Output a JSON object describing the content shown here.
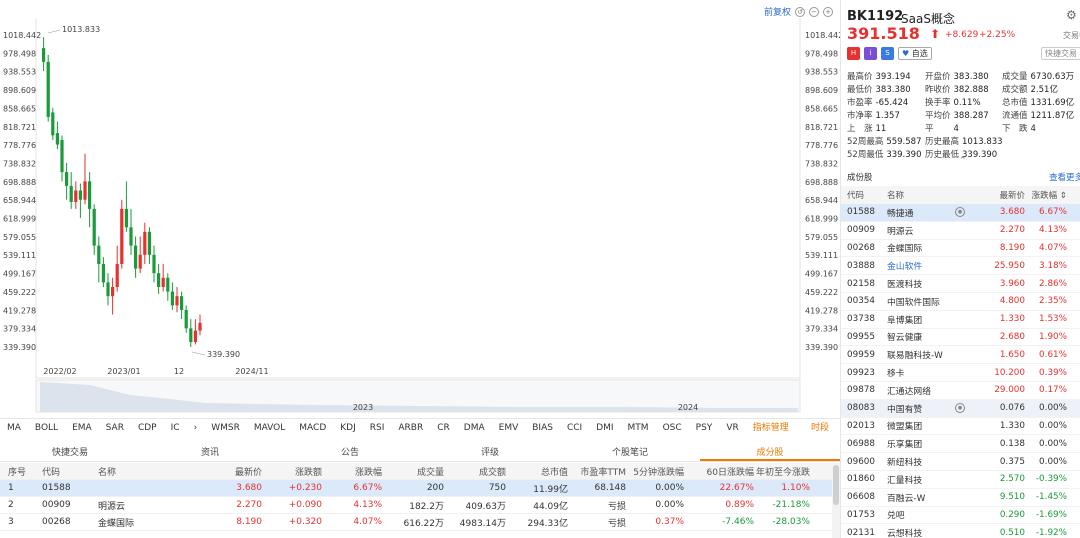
{
  "toolbar": {
    "restore_label": "前复权",
    "icons": [
      "undo-icon",
      "zoom-out-icon",
      "zoom-in-icon"
    ]
  },
  "chart": {
    "type": "candlestick",
    "y_ticks": [
      "1018.442",
      "978.498",
      "938.553",
      "898.609",
      "858.665",
      "818.721",
      "778.776",
      "738.832",
      "698.888",
      "658.944",
      "618.999",
      "579.055",
      "539.111",
      "499.167",
      "459.222",
      "419.278",
      "379.334",
      "339.390"
    ],
    "left_ticks": [
      "1018.442",
      "978.498",
      "938.553",
      "898.609",
      "858.665",
      "818.721",
      "778.776",
      "738.832",
      "698.888",
      "658.944",
      "618.999",
      "579.055",
      "539.111",
      "499.167",
      "459.222",
      "419.278",
      "379.334",
      "339.390"
    ],
    "x_ticks": [
      "2022/02",
      "2023/01",
      "12",
      "2024/11"
    ],
    "high_annotation": "1013.833",
    "low_annotation": "339.390",
    "colors": {
      "up": "#e8312f",
      "down": "#1a9b3a"
    },
    "nav_labels": [
      "2023",
      "2024"
    ]
  },
  "indicators": [
    "MA",
    "BOLL",
    "EMA",
    "SAR",
    "CDP",
    "IC",
    "WMSR",
    "MAVOL",
    "MACD",
    "KDJ",
    "RSI",
    "ARBR",
    "CR",
    "DMA",
    "EMV",
    "BIAS",
    "CCI",
    "DMI",
    "MTM",
    "OSC",
    "PSY",
    "VR"
  ],
  "indicator_extra": {
    "manage": "指标管理",
    "period": "时段"
  },
  "bottom_tabs": [
    "快捷交易",
    "资讯",
    "公告",
    "评级",
    "个股笔记",
    "成分股"
  ],
  "bottom_table": {
    "headers": [
      "序号",
      "代码",
      "名称",
      "最新价",
      "涨跌额",
      "涨跌幅",
      "成交量",
      "成交额",
      "总市值",
      "市盈率TTM",
      "5分钟涨跌幅",
      "60日涨跌幅",
      "年初至今涨跌"
    ],
    "rows": [
      [
        "1",
        "01588",
        "畅捷通",
        "3.680",
        "+0.230",
        "6.67%",
        "200",
        "750",
        "11.99亿",
        "68.148",
        "0.00%",
        "22.67%",
        "1.10%"
      ],
      [
        "2",
        "00909",
        "明源云",
        "2.270",
        "+0.090",
        "4.13%",
        "182.2万",
        "409.63万",
        "44.09亿",
        "亏损",
        "0.00%",
        "0.89%",
        "-21.18%"
      ],
      [
        "3",
        "00268",
        "金蝶国际",
        "8.190",
        "+0.320",
        "4.07%",
        "616.22万",
        "4983.14万",
        "294.33亿",
        "亏损",
        "0.37%",
        "-7.46%",
        "-28.03%"
      ]
    ]
  },
  "stock": {
    "code": "BK1192",
    "name": "SaaS概念",
    "price": "391.518",
    "change": "+8.629",
    "change_pct": "+2.25%",
    "trade_hint": "交易中",
    "fav_label": "自选",
    "fast_sell_label": "快捷交易",
    "badges": [
      "H",
      "i",
      "S"
    ]
  },
  "stats": [
    [
      {
        "l": "最高价",
        "v": "393.194",
        "c": "red"
      },
      {
        "l": "开盘价",
        "v": "383.380",
        "c": "red"
      },
      {
        "l": "成交量",
        "v": "6730.63万",
        "c": "gray"
      }
    ],
    [
      {
        "l": "最低价",
        "v": "383.380",
        "c": "red"
      },
      {
        "l": "昨收价",
        "v": "382.888",
        "c": "gray"
      },
      {
        "l": "成交额",
        "v": "2.51亿",
        "c": "gray"
      }
    ],
    [
      {
        "l": "市盈率",
        "v": "-65.424",
        "c": "gray"
      },
      {
        "l": "换手率",
        "v": "0.11%",
        "c": "gray"
      },
      {
        "l": "总市值",
        "v": "1331.69亿",
        "c": "gray"
      }
    ],
    [
      {
        "l": "市净率",
        "v": "1.357",
        "c": "gray"
      },
      {
        "l": "平均价",
        "v": "388.287",
        "c": "red"
      },
      {
        "l": "流通值",
        "v": "1211.87亿",
        "c": "gray"
      }
    ],
    [
      {
        "l": "上　涨",
        "v": "11",
        "c": "red"
      },
      {
        "l": "平　　",
        "v": "4",
        "c": "gray"
      },
      {
        "l": "下　跌",
        "v": "4",
        "c": "green"
      }
    ],
    [
      {
        "l": "52周最高",
        "v": "559.587",
        "c": "red"
      },
      {
        "l": "历史最高",
        "v": "1013.833",
        "c": "red"
      },
      {
        "l": "",
        "v": "",
        "c": "gray"
      }
    ],
    [
      {
        "l": "52周最低",
        "v": "339.390",
        "c": "green"
      },
      {
        "l": "历史最低",
        "v": "339.390",
        "c": "green"
      },
      {
        "l": "",
        "v": "",
        "c": "gray"
      }
    ]
  ],
  "components": {
    "title": "成份股",
    "more": "查看更多",
    "headers": [
      "代码",
      "名称",
      "最新价",
      "涨跌幅"
    ],
    "rows": [
      {
        "code": "01588",
        "name": "畅捷通",
        "price": "3.680",
        "pct": "6.67%",
        "dir": "up",
        "sel": true,
        "dot": true
      },
      {
        "code": "00909",
        "name": "明源云",
        "price": "2.270",
        "pct": "4.13%",
        "dir": "up"
      },
      {
        "code": "00268",
        "name": "金蝶国际",
        "price": "8.190",
        "pct": "4.07%",
        "dir": "up"
      },
      {
        "code": "03888",
        "name": "金山软件",
        "price": "25.950",
        "pct": "3.18%",
        "dir": "up",
        "blue": true
      },
      {
        "code": "02158",
        "name": "医渡科技",
        "price": "3.960",
        "pct": "2.86%",
        "dir": "up"
      },
      {
        "code": "00354",
        "name": "中国软件国际",
        "price": "4.800",
        "pct": "2.35%",
        "dir": "up"
      },
      {
        "code": "03738",
        "name": "阜博集团",
        "price": "1.330",
        "pct": "1.53%",
        "dir": "up"
      },
      {
        "code": "09955",
        "name": "智云健康",
        "price": "2.680",
        "pct": "1.90%",
        "dir": "up"
      },
      {
        "code": "09959",
        "name": "联易融科技-W",
        "price": "1.650",
        "pct": "0.61%",
        "dir": "up"
      },
      {
        "code": "09923",
        "name": "移卡",
        "price": "10.200",
        "pct": "0.39%",
        "dir": "up"
      },
      {
        "code": "09878",
        "name": "汇通达网络",
        "price": "29.000",
        "pct": "0.17%",
        "dir": "up"
      },
      {
        "code": "08083",
        "name": "中国有赞",
        "price": "0.076",
        "pct": "0.00%",
        "dir": "flat",
        "hl": true,
        "dot": true
      },
      {
        "code": "02013",
        "name": "微盟集团",
        "price": "1.330",
        "pct": "0.00%",
        "dir": "flat"
      },
      {
        "code": "06988",
        "name": "乐享集团",
        "price": "0.138",
        "pct": "0.00%",
        "dir": "flat"
      },
      {
        "code": "09600",
        "name": "新纽科技",
        "price": "0.375",
        "pct": "0.00%",
        "dir": "flat"
      },
      {
        "code": "01860",
        "name": "汇量科技",
        "price": "2.570",
        "pct": "-0.39%",
        "dir": "down"
      },
      {
        "code": "06608",
        "name": "百融云-W",
        "price": "9.510",
        "pct": "-1.45%",
        "dir": "down"
      },
      {
        "code": "01753",
        "name": "兑吧",
        "price": "0.290",
        "pct": "-1.69%",
        "dir": "down"
      },
      {
        "code": "02131",
        "name": "云想科技",
        "price": "0.510",
        "pct": "-1.92%",
        "dir": "down"
      }
    ]
  },
  "chart_data": {
    "type": "candlestick",
    "ylim": [
      339.39,
      1018.442
    ],
    "x_ticks": [
      "2022/02",
      "2023/01",
      "12",
      "2024/11"
    ],
    "candles": [
      [
        990,
        960,
        1013.8,
        940
      ],
      [
        960,
        840,
        975,
        830
      ],
      [
        850,
        800,
        860,
        790
      ],
      [
        805,
        780,
        830,
        770
      ],
      [
        790,
        720,
        800,
        700
      ],
      [
        720,
        690,
        740,
        660
      ],
      [
        690,
        655,
        720,
        640
      ],
      [
        655,
        680,
        700,
        640
      ],
      [
        680,
        660,
        695,
        620
      ],
      [
        660,
        700,
        760,
        650
      ],
      [
        700,
        640,
        720,
        600
      ],
      [
        640,
        560,
        650,
        540
      ],
      [
        560,
        520,
        580,
        480
      ],
      [
        520,
        480,
        535,
        470
      ],
      [
        480,
        450,
        500,
        430
      ],
      [
        450,
        470,
        490,
        410
      ],
      [
        470,
        520,
        560,
        460
      ],
      [
        520,
        640,
        660,
        510
      ],
      [
        640,
        600,
        700,
        590
      ],
      [
        600,
        560,
        640,
        540
      ],
      [
        560,
        510,
        580,
        490
      ],
      [
        510,
        540,
        580,
        500
      ],
      [
        540,
        590,
        610,
        520
      ],
      [
        590,
        540,
        600,
        520
      ],
      [
        540,
        500,
        560,
        480
      ],
      [
        500,
        470,
        520,
        455
      ],
      [
        470,
        490,
        520,
        460
      ],
      [
        490,
        460,
        500,
        440
      ],
      [
        460,
        430,
        480,
        420
      ],
      [
        430,
        450,
        470,
        415
      ],
      [
        450,
        420,
        460,
        400
      ],
      [
        420,
        380,
        430,
        370
      ],
      [
        380,
        350,
        400,
        339.4
      ],
      [
        350,
        375,
        400,
        345
      ],
      [
        375,
        392,
        410,
        365
      ]
    ]
  }
}
